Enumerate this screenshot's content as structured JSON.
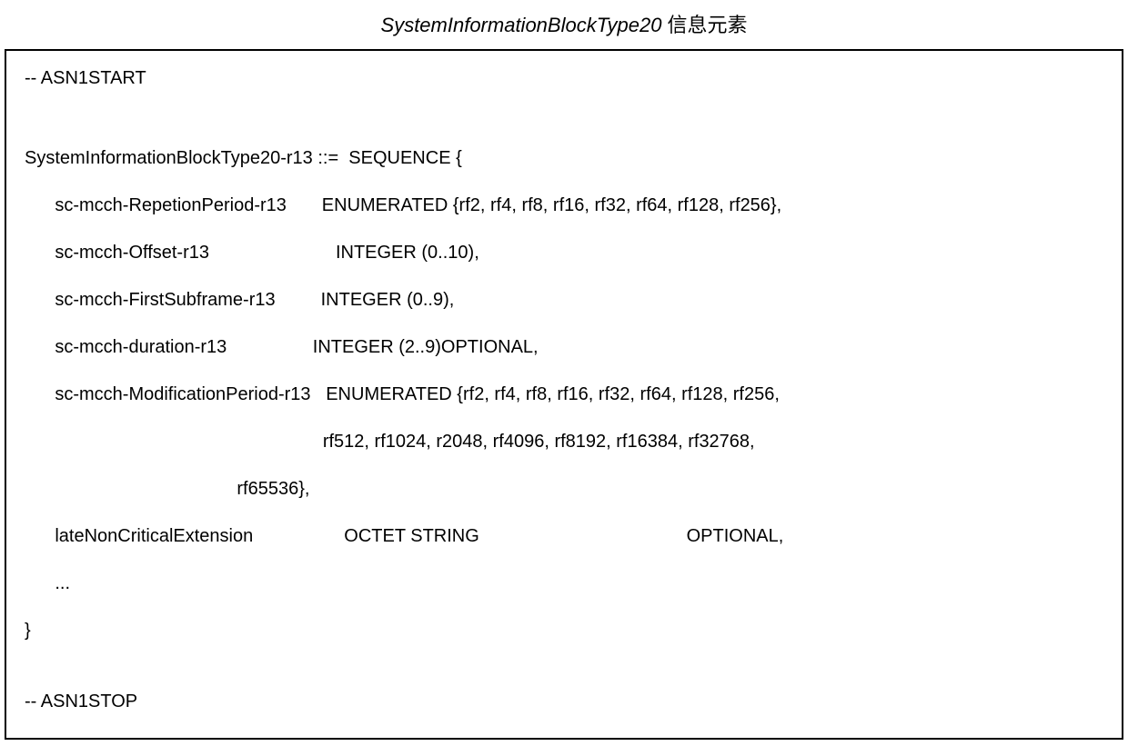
{
  "title": {
    "italic": "SystemInformationBlockType20",
    "chinese": "信息元素"
  },
  "code": {
    "asn1start": "-- ASN1START",
    "typedef_name": "SystemInformationBlockType20-r13 ::=",
    "sequence_open": "SEQUENCE {",
    "field1_name": "sc-mcch-RepetionPeriod-r13",
    "field1_type": "ENUMERATED {rf2, rf4, rf8, rf16, rf32, rf64, rf128, rf256},",
    "field2_name": "sc-mcch-Offset-r13",
    "field2_type": "INTEGER (0..10),",
    "field3_name": "sc-mcch-FirstSubframe-r13",
    "field3_type": "INTEGER (0..9),",
    "field4_name": "sc-mcch-duration-r13",
    "field4_type": "INTEGER (2..9)OPTIONAL,",
    "field5_name": "sc-mcch-ModificationPeriod-r13",
    "field5_type_l1": "ENUMERATED {rf2, rf4, rf8, rf16, rf32, rf64, rf128, rf256,",
    "field5_type_l2": "rf512, rf1024, r2048, rf4096, rf8192, rf16384, rf32768,",
    "field5_type_l3": "rf65536},",
    "field6_name": "lateNonCriticalExtension",
    "field6_type": "OCTET STRING",
    "field6_opt": "OPTIONAL,",
    "ellipsis": "...",
    "close_brace": "}",
    "asn1stop": "-- ASN1STOP"
  }
}
